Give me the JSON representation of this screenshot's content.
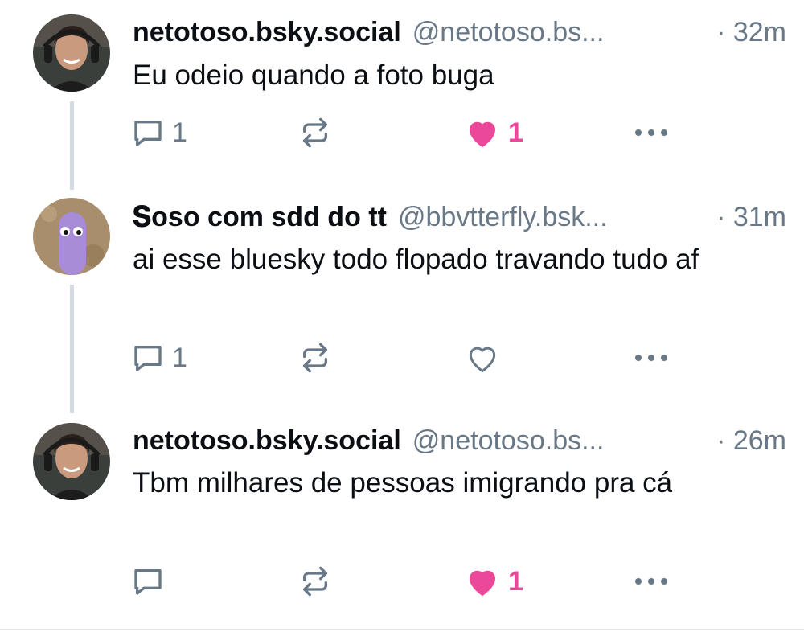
{
  "posts": [
    {
      "display_name": "netotoso.bsky.social",
      "handle": "@netotoso.bs...",
      "time": "· 32m",
      "text": "Eu odeio quando a foto buga",
      "reply_count": "1",
      "like_count": "1",
      "liked": true
    },
    {
      "display_name": "𝐒oso com sdd do tt",
      "handle": "@bbvtterfly.bsk...",
      "time": "· 31m",
      "text": "ai esse bluesky todo flopado travando tudo af",
      "reply_count": "1",
      "like_count": "",
      "liked": false
    },
    {
      "display_name": "netotoso.bsky.social",
      "handle": "@netotoso.bs...",
      "time": "· 26m",
      "text": "Tbm milhares de pessoas imigrando pra cá",
      "reply_count": "",
      "like_count": "1",
      "liked": true
    }
  ],
  "colors": {
    "muted": "#687887",
    "like": "#ec4899",
    "thread_line": "#d4dbe2",
    "text": "#0b0f14"
  },
  "icons": [
    "reply-icon",
    "repost-icon",
    "like-icon",
    "more-icon"
  ]
}
